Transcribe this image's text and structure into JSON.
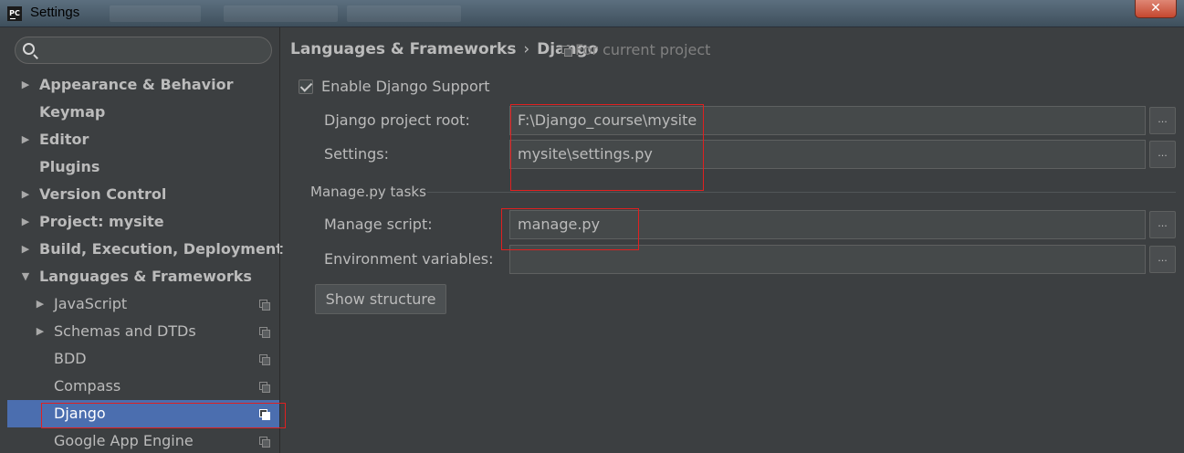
{
  "window": {
    "title": "Settings",
    "app_icon_text": "PC",
    "close_label": "✕"
  },
  "sidebar": {
    "search_placeholder": "",
    "items": [
      {
        "label": "Appearance & Behavior",
        "bold": true,
        "arrow": "▶"
      },
      {
        "label": "Keymap",
        "bold": true
      },
      {
        "label": "Editor",
        "bold": true,
        "arrow": "▶"
      },
      {
        "label": "Plugins",
        "bold": true
      },
      {
        "label": "Version Control",
        "bold": true,
        "arrow": "▶"
      },
      {
        "label": "Project: mysite",
        "bold": true,
        "arrow": "▶"
      },
      {
        "label": "Build, Execution, Deployment",
        "bold": true,
        "arrow": "▶"
      },
      {
        "label": "Languages & Frameworks",
        "bold": true,
        "arrow": "▼"
      },
      {
        "label": "JavaScript",
        "arrow": "▶",
        "project_icon": true
      },
      {
        "label": "Schemas and DTDs",
        "arrow": "▶",
        "project_icon": true
      },
      {
        "label": "BDD",
        "project_icon": true
      },
      {
        "label": "Compass",
        "project_icon": true
      },
      {
        "label": "Django",
        "project_icon": true,
        "selected": true
      },
      {
        "label": "Google App Engine",
        "project_icon": true
      }
    ]
  },
  "breadcrumb": {
    "parent": "Languages & Frameworks",
    "separator": "›",
    "current": "Django",
    "scope": "For current project"
  },
  "form": {
    "enable_label": "Enable Django Support",
    "enable_checked": true,
    "project_root_label": "Django project root:",
    "project_root_value": "F:\\Django_course\\mysite",
    "settings_label": "Settings:",
    "settings_value": "mysite\\settings.py",
    "manage_section": "Manage.py tasks",
    "manage_script_label": "Manage script:",
    "manage_script_value": "manage.py",
    "env_vars_label": "Environment variables:",
    "env_vars_value": "",
    "browse_label": "...",
    "show_structure_label": "Show structure"
  },
  "colors": {
    "background": "#3c3f41",
    "selection": "#4b6eaf",
    "annotation": "#e02020"
  }
}
